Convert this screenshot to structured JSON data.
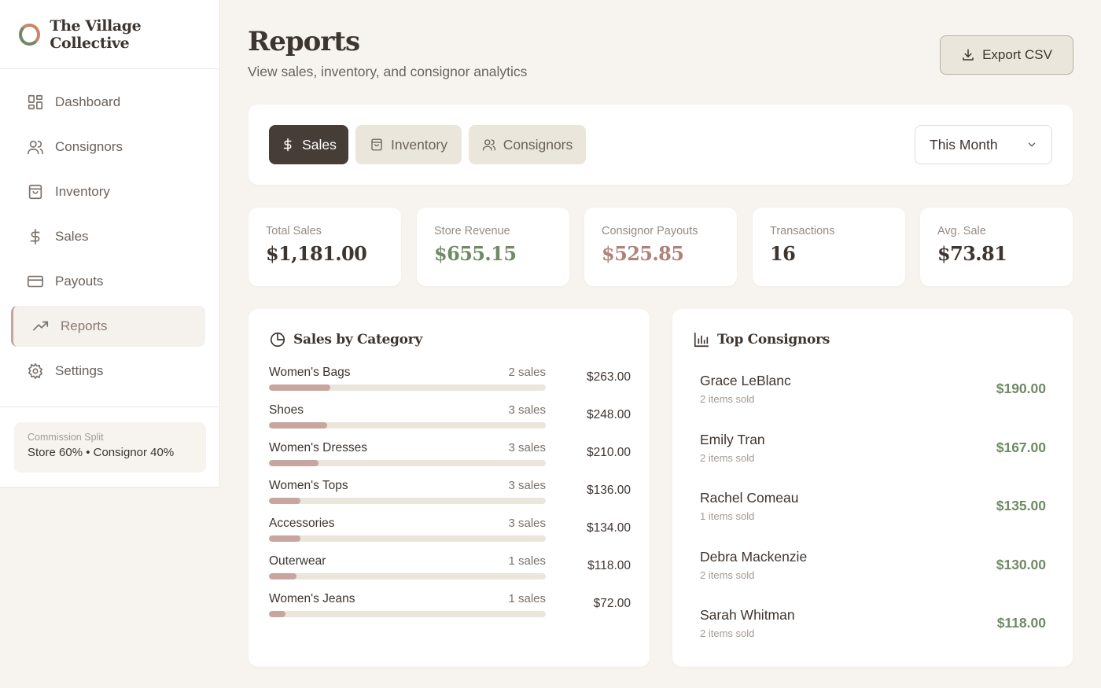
{
  "app": {
    "name": "The Village Collective"
  },
  "sidebar": {
    "items": [
      {
        "label": "Dashboard",
        "icon": "dashboard-icon"
      },
      {
        "label": "Consignors",
        "icon": "users-icon"
      },
      {
        "label": "Inventory",
        "icon": "shopping-bag-icon"
      },
      {
        "label": "Sales",
        "icon": "dollar-icon"
      },
      {
        "label": "Payouts",
        "icon": "credit-card-icon"
      },
      {
        "label": "Reports",
        "icon": "trending-up-icon",
        "active": true
      },
      {
        "label": "Settings",
        "icon": "gear-icon"
      }
    ],
    "commission": {
      "label": "Commission Split",
      "value": "Store 60% • Consignor 40%"
    }
  },
  "header": {
    "title": "Reports",
    "subtitle": "View sales, inventory, and consignor analytics",
    "export_label": "Export CSV"
  },
  "tabs": [
    {
      "label": "Sales",
      "active": true
    },
    {
      "label": "Inventory"
    },
    {
      "label": "Consignors"
    }
  ],
  "period": {
    "selected": "This Month"
  },
  "stats": [
    {
      "label": "Total Sales",
      "value": "$1,181.00",
      "color": "#3d3530"
    },
    {
      "label": "Store Revenue",
      "value": "$655.15",
      "color": "#6f8a64"
    },
    {
      "label": "Consignor Payouts",
      "value": "$525.85",
      "color": "#b0837a"
    },
    {
      "label": "Transactions",
      "value": "16",
      "color": "#3d3530"
    },
    {
      "label": "Avg. Sale",
      "value": "$73.81",
      "color": "#3d3530"
    }
  ],
  "sales_by_category": {
    "title": "Sales by Category",
    "rows": [
      {
        "name": "Women's Bags",
        "count": "2 sales",
        "amount": "$263.00",
        "share": 0.223
      },
      {
        "name": "Shoes",
        "count": "3 sales",
        "amount": "$248.00",
        "share": 0.21
      },
      {
        "name": "Women's Dresses",
        "count": "3 sales",
        "amount": "$210.00",
        "share": 0.178
      },
      {
        "name": "Women's Tops",
        "count": "3 sales",
        "amount": "$136.00",
        "share": 0.115
      },
      {
        "name": "Accessories",
        "count": "3 sales",
        "amount": "$134.00",
        "share": 0.113
      },
      {
        "name": "Outerwear",
        "count": "1 sales",
        "amount": "$118.00",
        "share": 0.1
      },
      {
        "name": "Women's Jeans",
        "count": "1 sales",
        "amount": "$72.00",
        "share": 0.061
      }
    ]
  },
  "top_consignors": {
    "title": "Top Consignors",
    "rows": [
      {
        "name": "Grace LeBlanc",
        "items": "2 items sold",
        "amount": "$190.00"
      },
      {
        "name": "Emily Tran",
        "items": "2 items sold",
        "amount": "$167.00"
      },
      {
        "name": "Rachel Comeau",
        "items": "1 items sold",
        "amount": "$135.00"
      },
      {
        "name": "Debra Mackenzie",
        "items": "2 items sold",
        "amount": "$130.00"
      },
      {
        "name": "Sarah Whitman",
        "items": "2 items sold",
        "amount": "$118.00"
      }
    ]
  },
  "colors": {
    "accent_dark": "#463d36",
    "positive": "#6f8a64",
    "bar": "#c9a59f",
    "track": "#ebe6dc"
  }
}
